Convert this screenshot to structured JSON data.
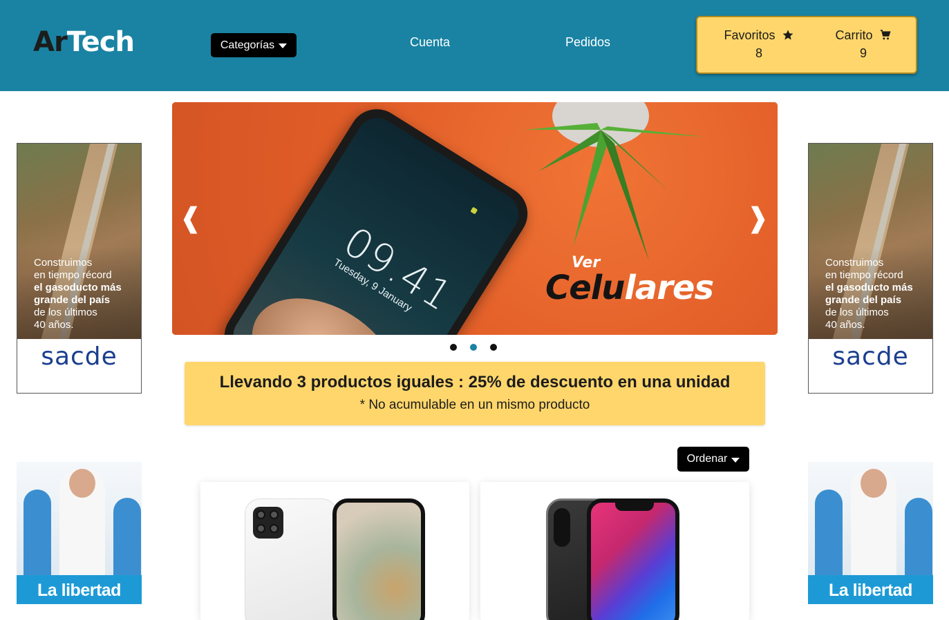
{
  "header": {
    "logo_part1": "Ar",
    "logo_part2": "Tech",
    "categories_label": "Categorías",
    "nav": {
      "account": "Cuenta",
      "orders": "Pedidos"
    },
    "favorites": {
      "label": "Favoritos",
      "count": "8"
    },
    "cart": {
      "label": "Carrito",
      "count": "9"
    },
    "colors": {
      "header_bg": "#1a83a3",
      "accent": "#ffd66b"
    }
  },
  "side_ads": {
    "top": {
      "line1": "Construimos",
      "line2": "en tiempo récord",
      "bold1": "el gasoducto más",
      "bold2": "grande del país",
      "line3": "de los últimos",
      "line4": "40 años.",
      "brand": "sacde"
    },
    "bottom": {
      "headline": "La libertad"
    }
  },
  "carousel": {
    "slide": {
      "phone_time": "09.41",
      "phone_date": "Tuesday, 9 January",
      "promo_small": "Ver",
      "promo_dark": "Celu",
      "promo_light": "lares"
    },
    "prev_symbol": "❰",
    "next_symbol": "❱",
    "slide_count": 3,
    "active_index": 1
  },
  "promo_banner": {
    "title": "Llevando 3 productos iguales : 25% de descuento en una unidad",
    "note": "* No acumulable en un mismo producto"
  },
  "products": {
    "sort_label": "Ordenar"
  }
}
